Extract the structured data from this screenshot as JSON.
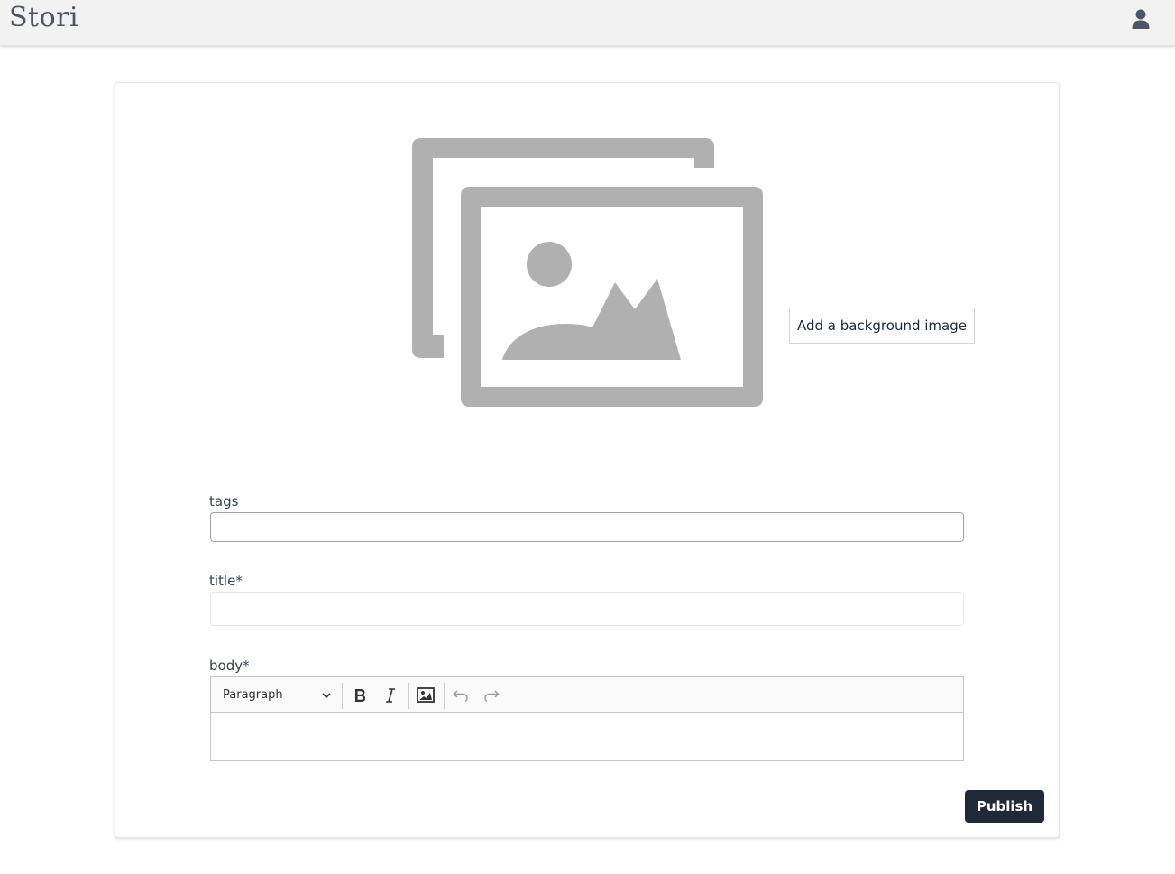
{
  "header": {
    "brand": "Stori",
    "user_icon": "user-icon"
  },
  "form": {
    "background_image_button": "Add a background image",
    "tags_label": "tags",
    "tags_value": "",
    "title_label": "title*",
    "title_value": "",
    "body_label": "body*",
    "editor": {
      "heading_select": "Paragraph",
      "toolbar_icons": [
        "bold-icon",
        "italic-icon",
        "insert-image-icon",
        "undo-icon",
        "redo-icon"
      ],
      "content": ""
    },
    "publish_label": "Publish"
  },
  "colors": {
    "topbar_bg": "#f2f2f2",
    "placeholder_gray": "#b0b0b0",
    "publish_bg": "#1f2937"
  }
}
